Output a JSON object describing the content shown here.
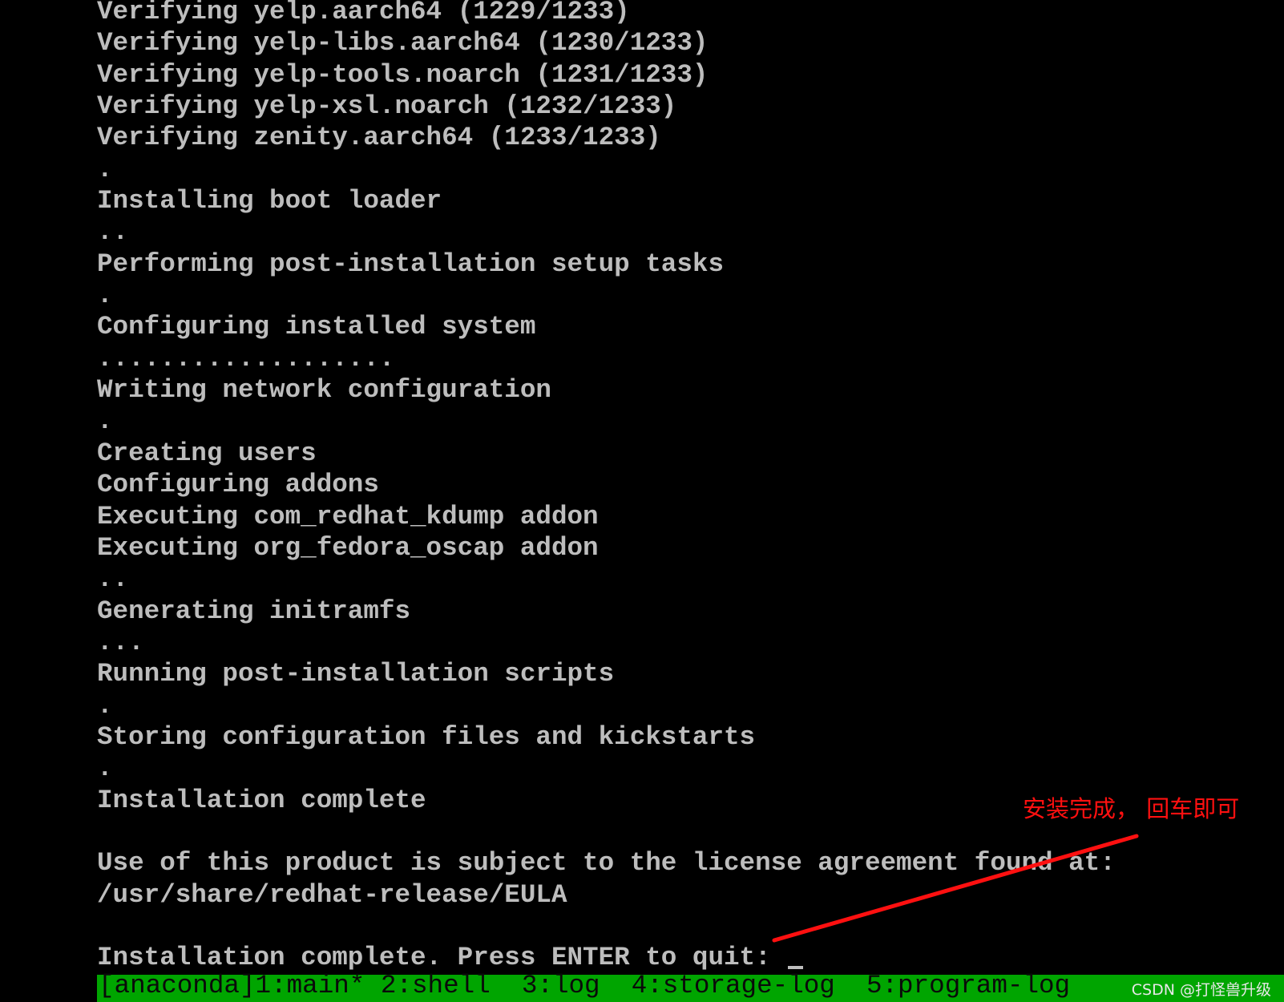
{
  "terminal": {
    "lines": [
      "Verifying yelp.aarch64 (1229/1233)",
      "Verifying yelp-libs.aarch64 (1230/1233)",
      "Verifying yelp-tools.noarch (1231/1233)",
      "Verifying yelp-xsl.noarch (1232/1233)",
      "Verifying zenity.aarch64 (1233/1233)",
      ".",
      "Installing boot loader",
      "..",
      "Performing post-installation setup tasks",
      ".",
      "Configuring installed system",
      "...................",
      "Writing network configuration",
      ".",
      "Creating users",
      "Configuring addons",
      "Executing com_redhat_kdump addon",
      "Executing org_fedora_oscap addon",
      "..",
      "Generating initramfs",
      "...",
      "Running post-installation scripts",
      ".",
      "Storing configuration files and kickstarts",
      ".",
      "Installation complete",
      "",
      "Use of this product is subject to the license agreement found at:",
      "/usr/share/redhat-release/EULA",
      ""
    ],
    "prompt": "Installation complete. Press ENTER to quit: "
  },
  "statusbar": {
    "text": "[anaconda]1:main* 2:shell  3:log  4:storage-log  5:program-log"
  },
  "annotation": {
    "text": "安装完成， 回车即可",
    "color": "#ff1010"
  },
  "watermark": "CSDN @打怪兽升级"
}
